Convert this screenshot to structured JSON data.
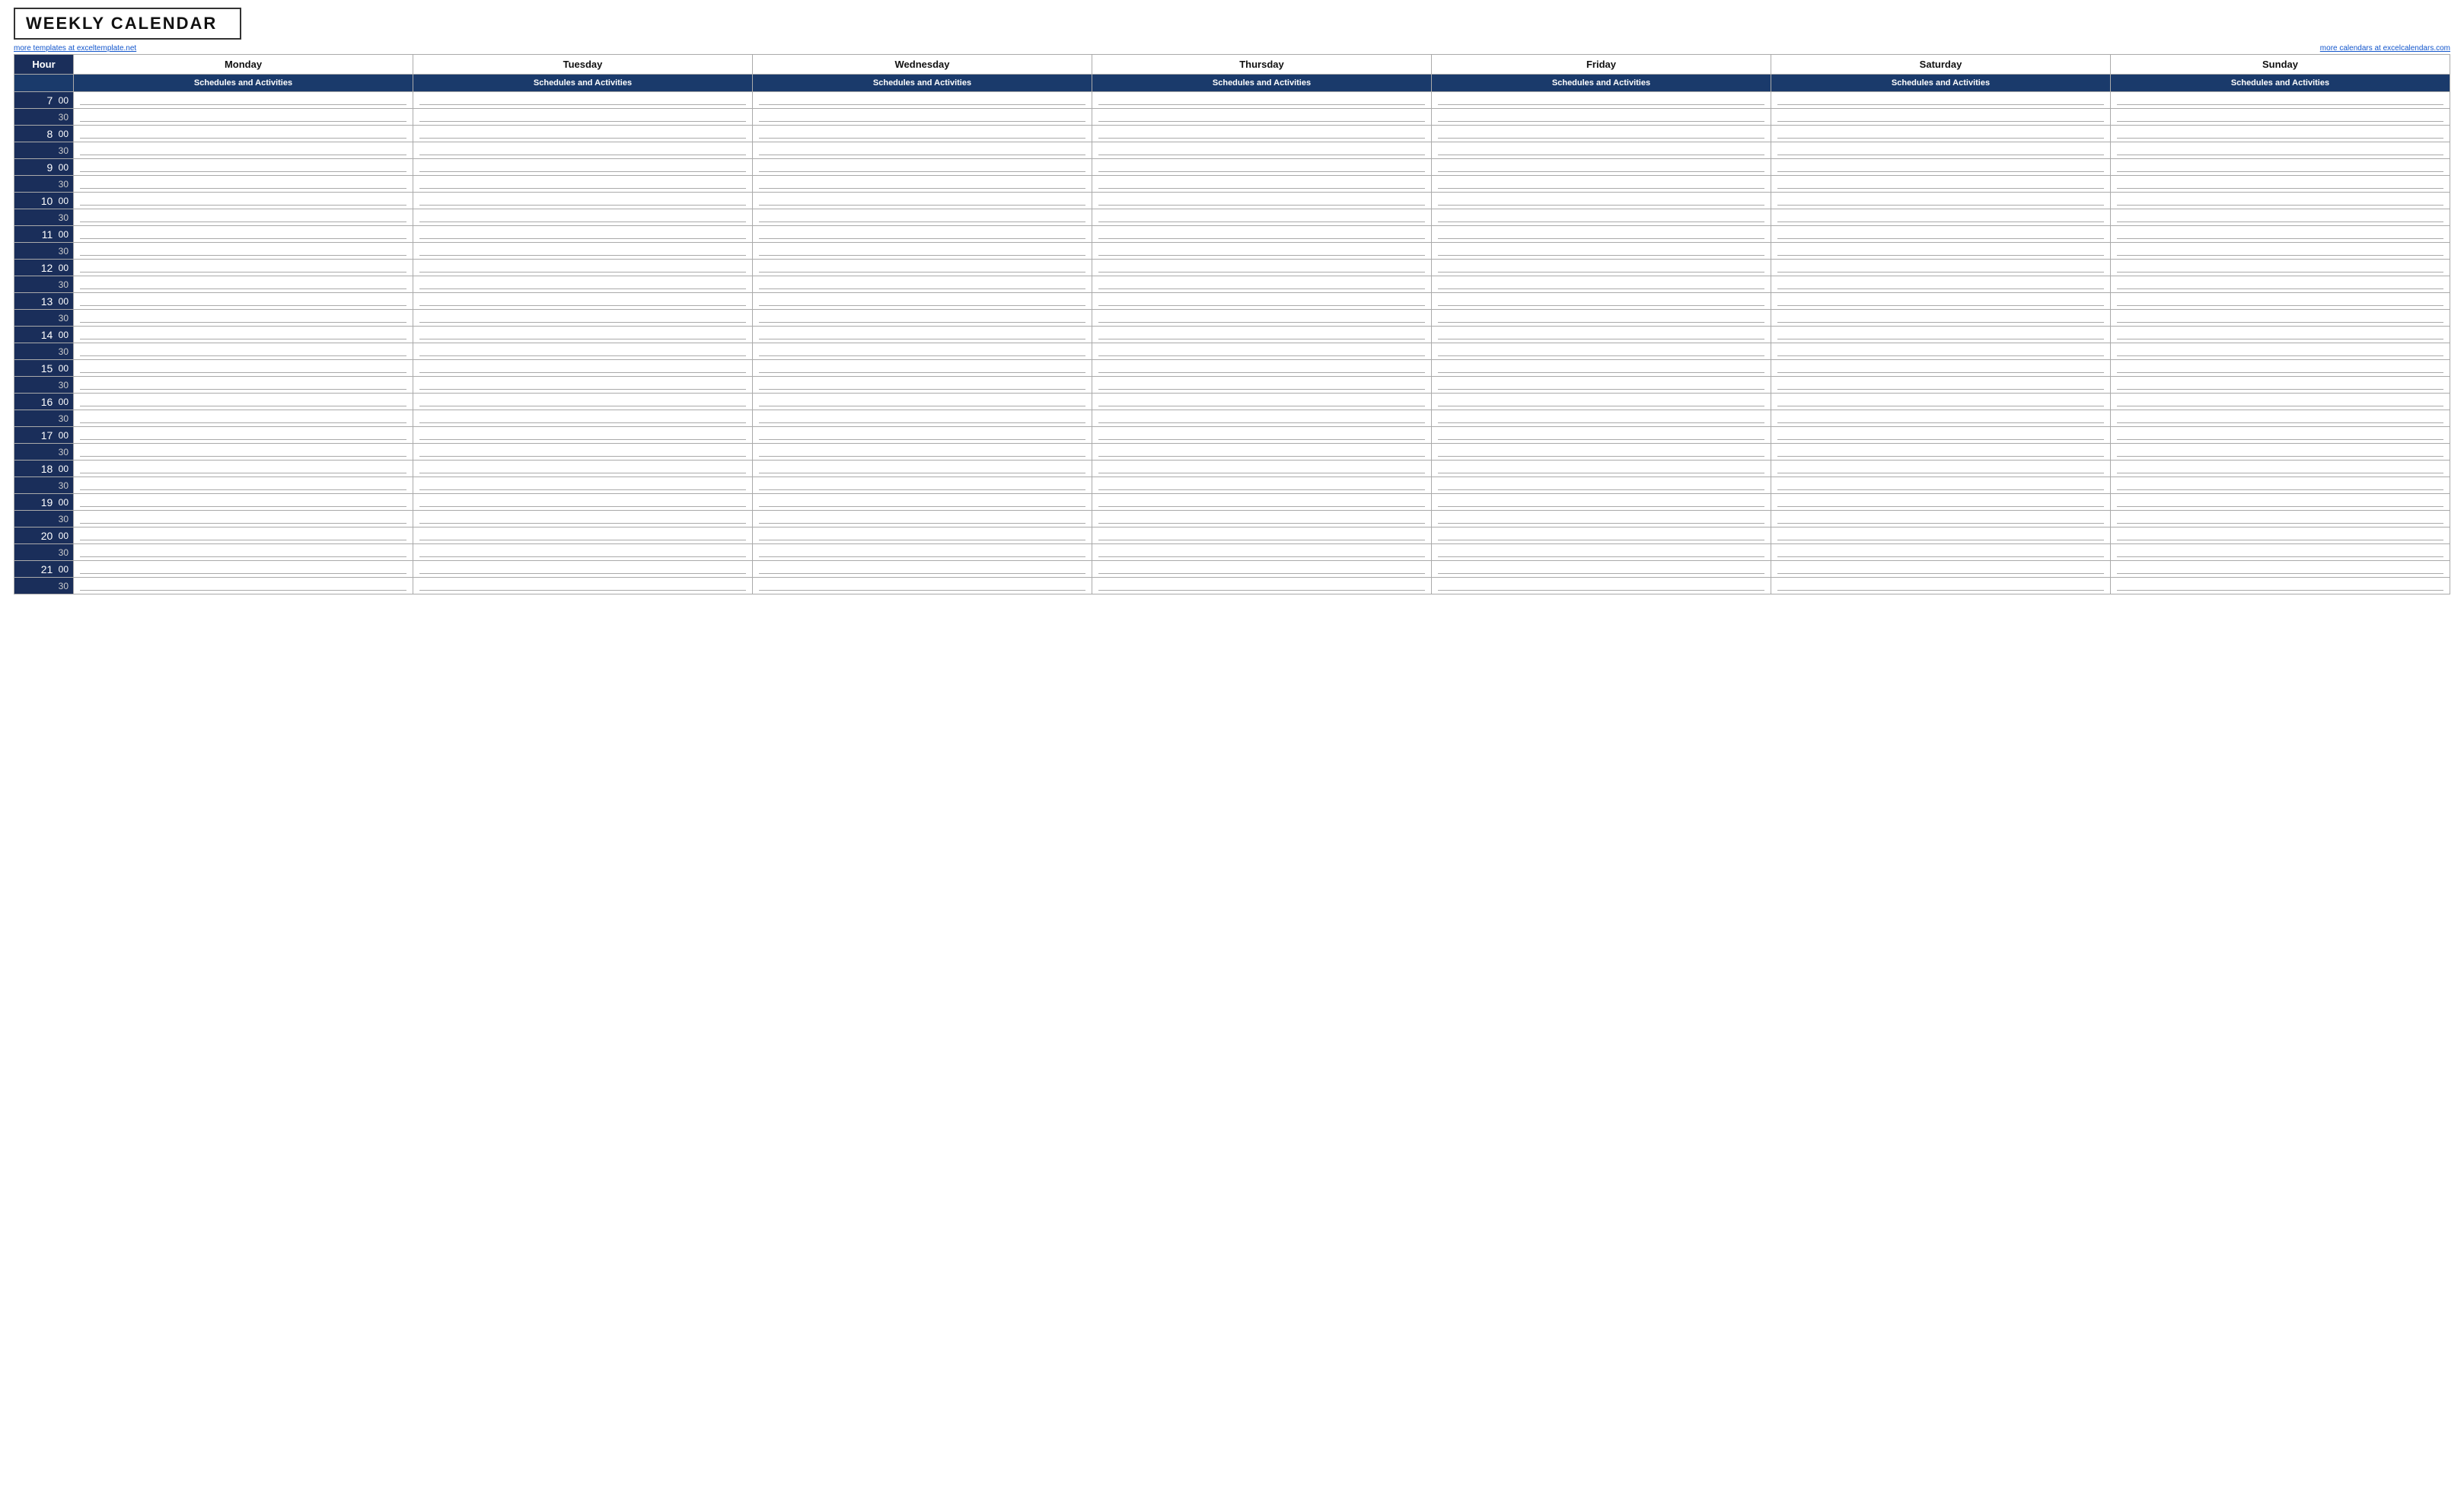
{
  "header": {
    "title": "WEEKLY CALENDAR",
    "link_left": "more templates at exceltemplate.net",
    "link_right": "more calendars at excelcalendars.com"
  },
  "columns": {
    "hour_label": "Hour",
    "days": [
      "Monday",
      "Tuesday",
      "Wednesday",
      "Thursday",
      "Friday",
      "Saturday",
      "Sunday"
    ],
    "sub_label": "Schedules and Activities"
  },
  "hours": [
    {
      "hour": 7,
      "min": "00"
    },
    {
      "hour": null,
      "min": "30"
    },
    {
      "hour": 8,
      "min": "00"
    },
    {
      "hour": null,
      "min": "30"
    },
    {
      "hour": 9,
      "min": "00"
    },
    {
      "hour": null,
      "min": "30"
    },
    {
      "hour": 10,
      "min": "00"
    },
    {
      "hour": null,
      "min": "30"
    },
    {
      "hour": 11,
      "min": "00"
    },
    {
      "hour": null,
      "min": "30"
    },
    {
      "hour": 12,
      "min": "00"
    },
    {
      "hour": null,
      "min": "30"
    },
    {
      "hour": 13,
      "min": "00"
    },
    {
      "hour": null,
      "min": "30"
    },
    {
      "hour": 14,
      "min": "00"
    },
    {
      "hour": null,
      "min": "30"
    },
    {
      "hour": 15,
      "min": "00"
    },
    {
      "hour": null,
      "min": "30"
    },
    {
      "hour": 16,
      "min": "00"
    },
    {
      "hour": null,
      "min": "30"
    },
    {
      "hour": 17,
      "min": "00"
    },
    {
      "hour": null,
      "min": "30"
    },
    {
      "hour": 18,
      "min": "00"
    },
    {
      "hour": null,
      "min": "30"
    },
    {
      "hour": 19,
      "min": "00"
    },
    {
      "hour": null,
      "min": "30"
    },
    {
      "hour": 20,
      "min": "00"
    },
    {
      "hour": null,
      "min": "30"
    },
    {
      "hour": 21,
      "min": "00"
    },
    {
      "hour": null,
      "min": "30"
    }
  ]
}
